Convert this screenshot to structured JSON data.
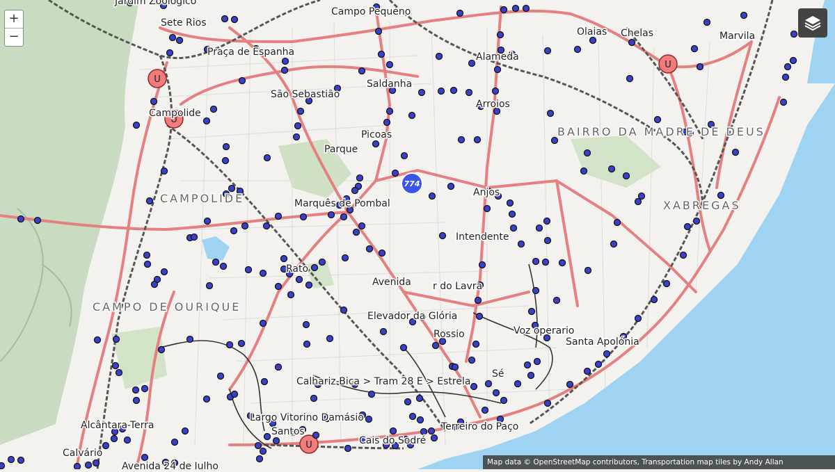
{
  "controls": {
    "zoom_in": "+",
    "zoom_out": "−",
    "layers_icon": "layers-icon"
  },
  "attribution": "Map data © OpenStreetMap contributors, Transportation map tiles by Andy Allan",
  "cluster": {
    "count": "774"
  },
  "metro_symbol": "U",
  "labels": [
    "Sete Rios",
    "Campo Pequeno",
    "Olaias",
    "Chelas",
    "Marvila",
    "Praça de Espanha",
    "Alameda",
    "São Sebastião",
    "Saldanha",
    "Arroios",
    "Campolide",
    "Picoas",
    "Parque",
    "BAIRRO DA MADRE DE DEUS",
    "Anjos",
    "CAMPOLIDE",
    "Marquês de Pombal",
    "XABREGAS",
    "Intendente",
    "Rato",
    "Avenida",
    "r do Lavra",
    "CAMPO DE OURIQUE",
    "Elevador da Glória",
    "Rossio",
    "Voz operario",
    "Santa Apolónia",
    "Calhariz-Bica > Tram 28 E > Estrela",
    "Sé",
    "Largo Vitorino Damásio",
    "Santos",
    "Terreiro do Paço",
    "Cais do Sodré",
    "Alcântara-Terra",
    "Calvário",
    "Avenida 24 de Julho",
    "Jardim Zoológico"
  ],
  "colors": {
    "land": "#f3f2ef",
    "park": "#c8dcc0",
    "water": "#9fd3f2",
    "road": "#e06666",
    "rail": "#555555",
    "stop": "#3940c9",
    "metro": "#f07c7c"
  }
}
